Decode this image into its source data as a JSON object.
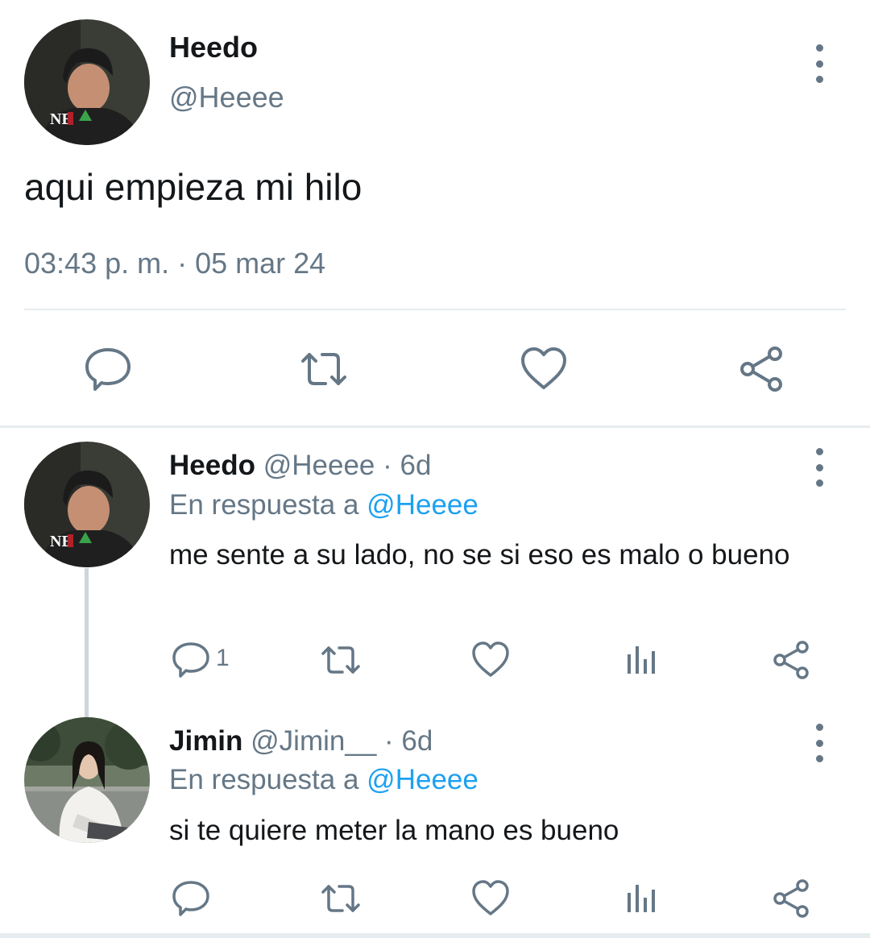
{
  "main_tweet": {
    "name": "Heedo",
    "handle": "@Heeee",
    "text": "aqui empieza mi hilo",
    "timestamp": "03:43 p. m. · 05 mar 24",
    "avatar_text": "NE",
    "actions": [
      "reply-icon",
      "retweet-icon",
      "like-icon",
      "share-icon"
    ]
  },
  "replies": [
    {
      "name": "Heedo",
      "handle": "@Heeee · 6d",
      "reply_prefix": "En respuesta a",
      "reply_mention": "@Heeee",
      "text": "me sente a su lado, no se si eso es malo o bueno",
      "reply_count": "1",
      "avatar_text": "NE"
    },
    {
      "name": "Jimin",
      "handle": "@Jimin__ · 6d",
      "reply_prefix": "En respuesta a",
      "reply_mention": "@Heeee",
      "text": "si te quiere meter la mano es bueno",
      "reply_count": ""
    }
  ],
  "colors": {
    "text": "#14171a",
    "secondary": "#657786",
    "accent": "#1da1f2",
    "divider": "#e6ecf0"
  }
}
